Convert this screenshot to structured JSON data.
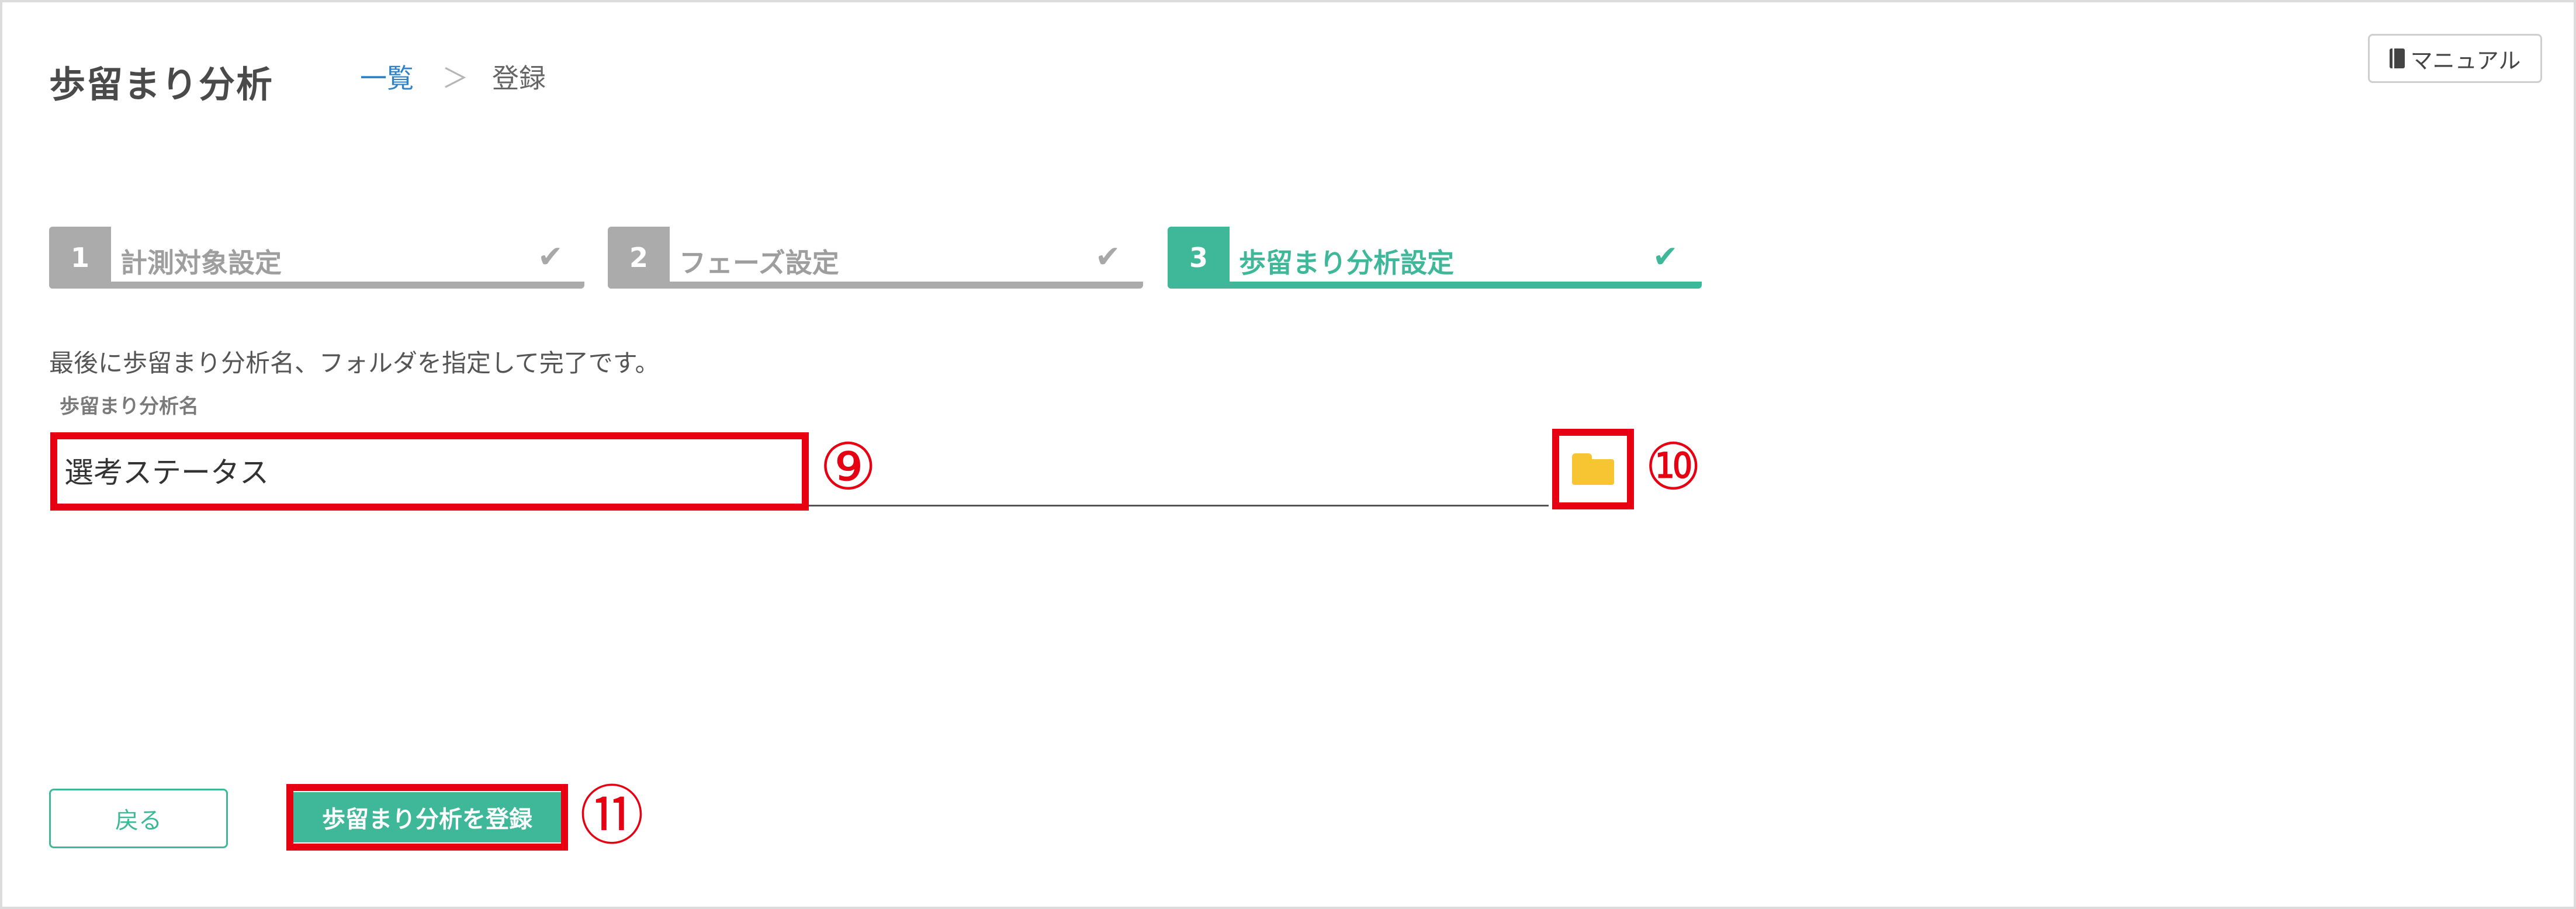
{
  "header": {
    "title": "歩留まり分析",
    "breadcrumb": {
      "link": "一覧",
      "separator": "＞",
      "current": "登録"
    },
    "manual_label": "マニュアル",
    "manual_icon": "book-icon"
  },
  "steps": [
    {
      "number": "1",
      "label": "計測対象設定",
      "status": "done"
    },
    {
      "number": "2",
      "label": "フェーズ設定",
      "status": "done"
    },
    {
      "number": "3",
      "label": "歩留まり分析設定",
      "status": "active"
    }
  ],
  "check_mark": "✔",
  "form": {
    "description": "最後に歩留まり分析名、フォルダを指定して完了です。",
    "name_label": "歩留まり分析名",
    "name_value": "選考ステータス",
    "folder_icon": "folder-icon"
  },
  "footer": {
    "back_label": "戻る",
    "register_label": "歩留まり分析を登録"
  },
  "annotations": {
    "callout_9": "⑨",
    "callout_10": "⑩",
    "callout_11": "⑪"
  },
  "colors": {
    "accent": "#3fb899",
    "step_done": "#ababab",
    "highlight": "#e60012",
    "folder": "#f7c531",
    "link": "#2f82c8"
  }
}
